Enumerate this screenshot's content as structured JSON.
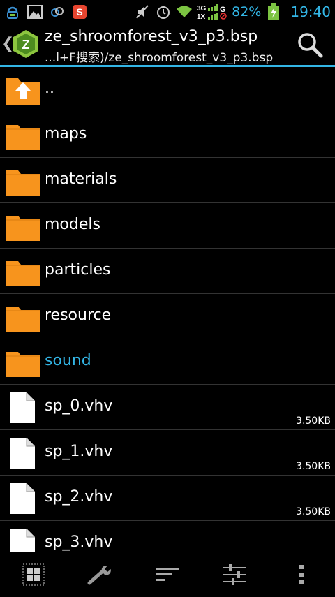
{
  "status_bar": {
    "battery_percent": "82%",
    "time": "19:40",
    "network_top": "3G",
    "network_bottom": "1X",
    "signal_label": "G",
    "icons": [
      "sync-icon",
      "screenshot-icon",
      "gallery-icon",
      "app-icon",
      "sogou-icon",
      "mute-icon",
      "alarm-icon",
      "wifi-icon",
      "signal-icon",
      "battery-icon"
    ]
  },
  "title": {
    "main": "ze_shroomforest_v3_p3.bsp",
    "path": "...l+F搜索)/ze_shroomforest_v3_p3.bsp"
  },
  "list": {
    "items": [
      {
        "name": "..",
        "type": "up",
        "size": ""
      },
      {
        "name": "maps",
        "type": "folder",
        "size": ""
      },
      {
        "name": "materials",
        "type": "folder",
        "size": ""
      },
      {
        "name": "models",
        "type": "folder",
        "size": ""
      },
      {
        "name": "particles",
        "type": "folder",
        "size": ""
      },
      {
        "name": "resource",
        "type": "folder",
        "size": ""
      },
      {
        "name": "sound",
        "type": "folder",
        "size": "",
        "highlight": true
      },
      {
        "name": "sp_0.vhv",
        "type": "file",
        "size": "3.50KB"
      },
      {
        "name": "sp_1.vhv",
        "type": "file",
        "size": "3.50KB"
      },
      {
        "name": "sp_2.vhv",
        "type": "file",
        "size": "3.50KB"
      },
      {
        "name": "sp_3.vhv",
        "type": "file",
        "size": ""
      }
    ]
  },
  "bottom_bar": {
    "buttons": [
      "grid-view-icon",
      "tools-icon",
      "sort-icon",
      "filter-icon",
      "more-icon"
    ]
  },
  "colors": {
    "accent": "#33b5e5",
    "folder": "#f7941d",
    "background": "#000000"
  }
}
